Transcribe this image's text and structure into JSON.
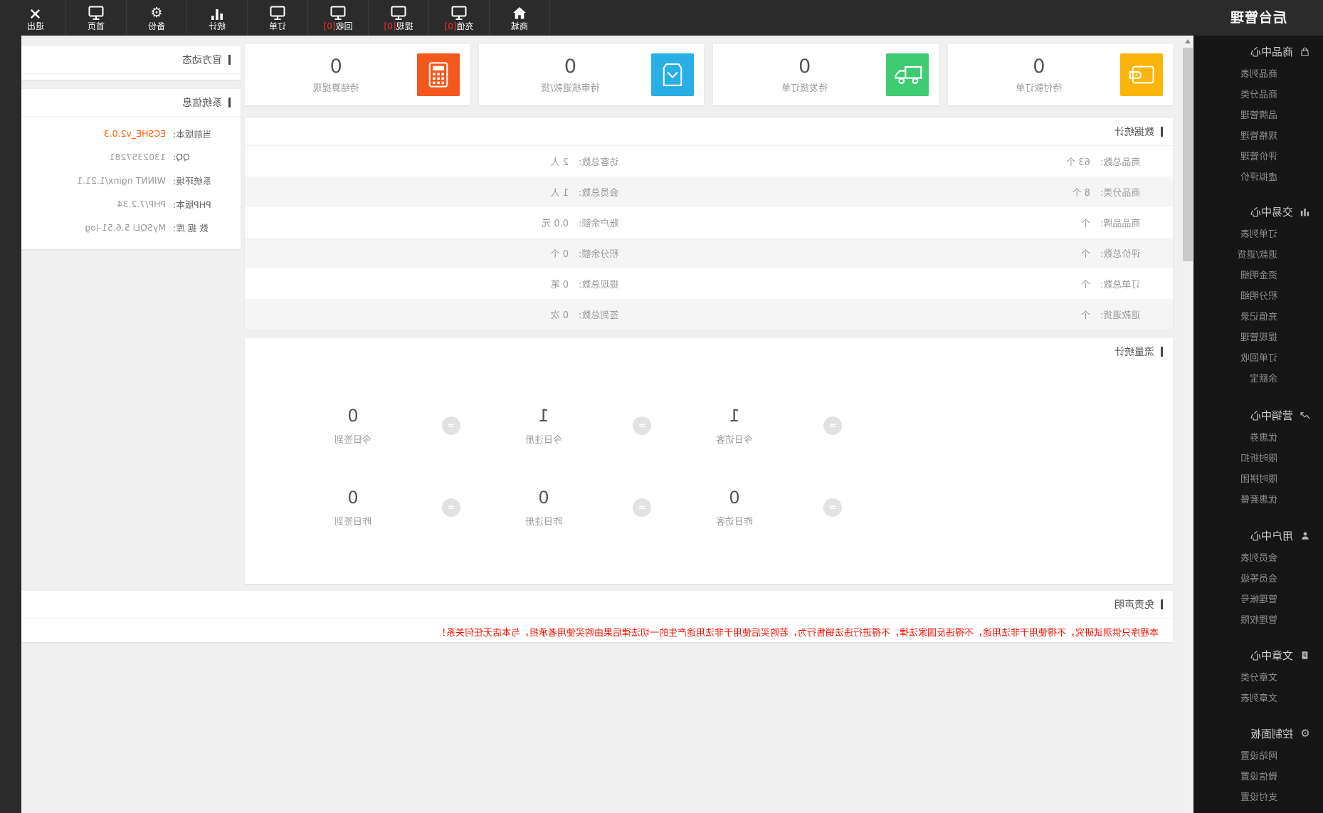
{
  "topbar": {
    "logo": "后台管理",
    "items": [
      {
        "icon": "home-icon",
        "label": "商城"
      },
      {
        "icon": "monitor-icon",
        "label": "充值",
        "badge": "[0]"
      },
      {
        "icon": "monitor-icon",
        "label": "提现",
        "badge": "[0]"
      },
      {
        "icon": "monitor-icon",
        "label": "回收",
        "badge": "[0]"
      },
      {
        "icon": "monitor-icon",
        "label": "订单"
      },
      {
        "icon": "bar-chart-icon",
        "label": "统计"
      },
      {
        "icon": "gear-icon",
        "label": "备份"
      },
      {
        "icon": "monitor-icon",
        "label": "首页"
      },
      {
        "icon": "x-icon",
        "label": "退出"
      }
    ]
  },
  "sidebar": {
    "sections": [
      {
        "title": "商品中心",
        "icon": "bag-icon",
        "items": [
          "商品列表",
          "商品分类",
          "品牌管理",
          "规格管理",
          "评价管理",
          "虚拟评价"
        ]
      },
      {
        "title": "交易中心",
        "icon": "bar-chart-icon",
        "items": [
          "订单列表",
          "退款/退货",
          "资金明细",
          "积分明细",
          "充值记录",
          "提现管理",
          "订单回收",
          "余额宝"
        ]
      },
      {
        "title": "营销中心",
        "icon": "trend-icon",
        "items": [
          "优惠券",
          "限时折扣",
          "限时拼团",
          "优惠套餐"
        ]
      },
      {
        "title": "用户中心",
        "icon": "user-icon",
        "items": [
          "会员列表",
          "会员等级",
          "管理帐号",
          "管理权限"
        ]
      },
      {
        "title": "文章中心",
        "icon": "document-icon",
        "items": [
          "文章分类",
          "文章列表"
        ]
      },
      {
        "title": "控制面板",
        "icon": "gear-icon",
        "items": [
          "网站设置",
          "微信设置",
          "支付设置"
        ]
      }
    ]
  },
  "cards": [
    {
      "value": "0",
      "label": "待付款订单",
      "icon": "wallet-icon",
      "color": "#fbb50a"
    },
    {
      "value": "0",
      "label": "待发货订单",
      "icon": "truck-icon",
      "color": "#3ecb71"
    },
    {
      "value": "0",
      "label": "待审核退款/货",
      "icon": "box-icon",
      "color": "#29aee8"
    },
    {
      "value": "0",
      "label": "待结算提现",
      "icon": "calculator-icon",
      "color": "#f4581c"
    }
  ],
  "data_stats": {
    "title": "数据统计",
    "rows": [
      [
        {
          "label": "商品总数:",
          "value": "63 个"
        },
        {
          "label": "访客总数:",
          "value": "2 人"
        }
      ],
      [
        {
          "label": "商品分类:",
          "value": "8 个"
        },
        {
          "label": "会员总数:",
          "value": "1 人"
        }
      ],
      [
        {
          "label": "商品品牌:",
          "value": "个"
        },
        {
          "label": "账户余额:",
          "value": "0.0 元"
        }
      ],
      [
        {
          "label": "评价总数:",
          "value": "个"
        },
        {
          "label": "积分余额:",
          "value": "0 个"
        }
      ],
      [
        {
          "label": "订单总数:",
          "value": "个"
        },
        {
          "label": "提现总数:",
          "value": "0 笔"
        }
      ],
      [
        {
          "label": "退款退货:",
          "value": "个"
        },
        {
          "label": "签到总数:",
          "value": "0 次"
        }
      ]
    ]
  },
  "traffic_stats": {
    "title": "流量统计",
    "circle_glyph": "=",
    "rows": [
      [
        {
          "value": "1",
          "label": "今日访客"
        },
        {
          "value": "1",
          "label": "今日注册"
        },
        {
          "value": "0",
          "label": "今日签到"
        }
      ],
      [
        {
          "value": "0",
          "label": "昨日访客"
        },
        {
          "value": "0",
          "label": "昨日注册"
        },
        {
          "value": "0",
          "label": "昨日签到"
        }
      ]
    ]
  },
  "disclaimer": {
    "title": "免责声明",
    "text": "本程序只供测试研究，不得使用于非法用途，不得违反国家法律，不得进行违法销售行为，若购买后使用于非法用途产生的一切法律后果由购买使用者承担，与本店无任何关系！"
  },
  "news": {
    "title": "官方动态"
  },
  "system_info": {
    "title": "系统信息",
    "rows": [
      {
        "label": "当前版本:",
        "value": "ECSHE_v2.0.3"
      },
      {
        "label": "QQ:",
        "value": "1302357281"
      },
      {
        "label": "系统环境:",
        "value": "WINNT nginx/1.21.1"
      },
      {
        "label": "PHP版本:",
        "value": "PHP/7.2.34"
      },
      {
        "label": "数 据 库:",
        "value": "MySQLi 5.6.51-log"
      }
    ]
  },
  "colors": {
    "topbar_bg": "#2b2b2b",
    "sidebar_bg": "#161616",
    "page_bg": "#f0f0f0",
    "card_yellow": "#fbb50a",
    "card_green": "#3ecb71",
    "card_blue": "#29aee8",
    "card_orange": "#f4581c",
    "badge_red": "#ff2b2b",
    "disclaimer_red": "#f21000",
    "version_orange": "#ff5a00"
  },
  "note": "screenshot is horizontally mirrored"
}
